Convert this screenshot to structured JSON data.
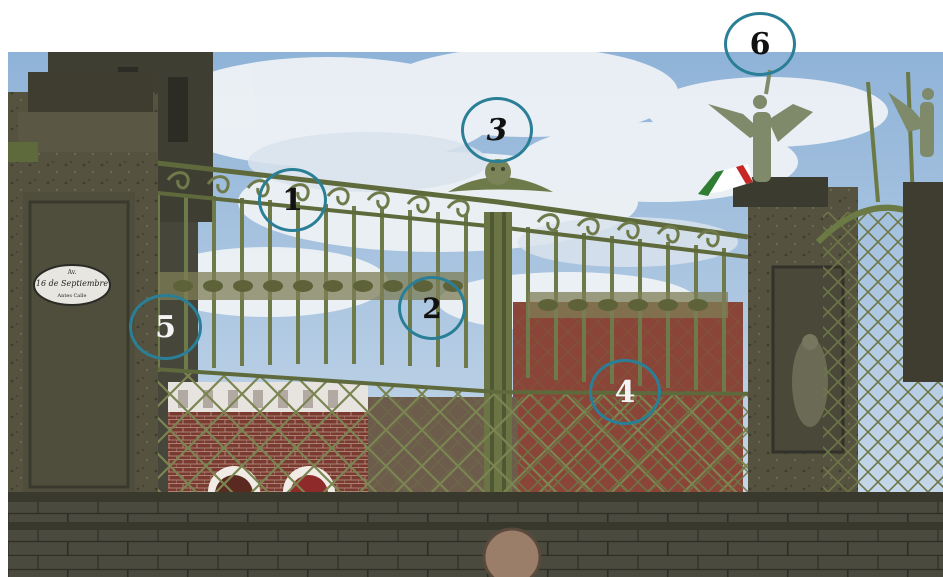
{
  "photo": {
    "subject": "wrought-iron-fence-with-stone-pillars-and-angel-statues",
    "colors": {
      "sky": "#9fc0df",
      "cloud": "#eef2f6",
      "ironwork": "#6f7a4a",
      "stone": "#4a4a3c",
      "brick": "#7a3a30",
      "marker_ring": "#2a7f96"
    },
    "plaque_text": {
      "line1": "Av.",
      "line2": "16 de Septiembre",
      "line3": "Antes Calle"
    }
  },
  "markers": [
    {
      "label": "1"
    },
    {
      "label": "2"
    },
    {
      "label": "3"
    },
    {
      "label": "4"
    },
    {
      "label": "5"
    },
    {
      "label": "6"
    }
  ]
}
